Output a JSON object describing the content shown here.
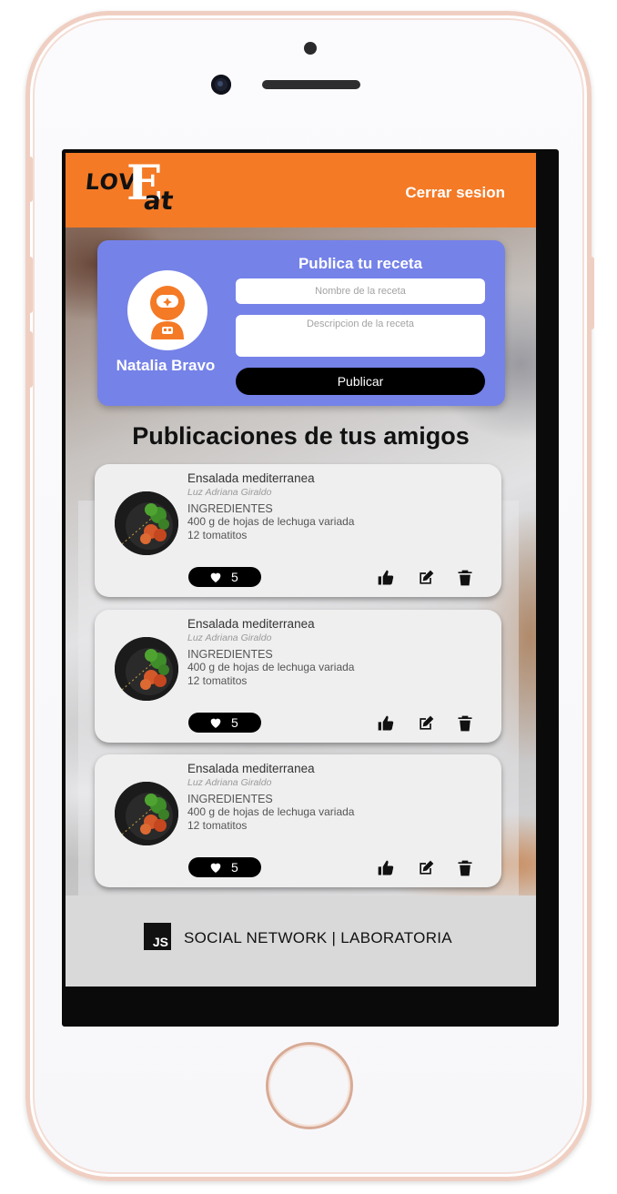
{
  "app": {
    "logo_text_left": "LOV",
    "logo_text_e": "E",
    "logo_text_right": "at",
    "logout_label": "Cerrar sesion"
  },
  "profile": {
    "user_name": "Natalia Bravo",
    "form_title": "Publica tu receta",
    "title_placeholder": "Nombre de la receta",
    "desc_placeholder": "Descripcion de la receta",
    "publish_label": "Publicar"
  },
  "feed": {
    "title": "Publicaciones de tus amigos",
    "posts": [
      {
        "title": "Ensalada mediterranea",
        "author": "Luz Adriana Giraldo",
        "ingredients_label": "INGREDIENTES",
        "line1": "400 g de hojas de lechuga variada",
        "line2": "12 tomatitos",
        "likes": "5"
      },
      {
        "title": "Ensalada mediterranea",
        "author": "Luz Adriana Giraldo",
        "ingredients_label": "INGREDIENTES",
        "line1": "400 g de hojas de lechuga variada",
        "line2": "12 tomatitos",
        "likes": "5"
      },
      {
        "title": "Ensalada mediterranea",
        "author": "Luz Adriana Giraldo",
        "ingredients_label": "INGREDIENTES",
        "line1": "400 g de hojas de lechuga variada",
        "line2": "12 tomatitos",
        "likes": "5"
      }
    ]
  },
  "footer": {
    "logo_text": "JS",
    "text": "SOCIAL NETWORK | LABORATORIA"
  },
  "icons": {
    "avatar": "astronaut-avatar-icon",
    "like": "heart-icon",
    "thumbs_up": "thumbs-up-icon",
    "edit": "edit-icon",
    "delete": "trash-icon"
  },
  "colors": {
    "header": "#f47a26",
    "profile_card": "#7582e8",
    "avatar_orange": "#f47a26",
    "footer": "#d9d9d9",
    "phone_frame": "#f0cfc3"
  }
}
